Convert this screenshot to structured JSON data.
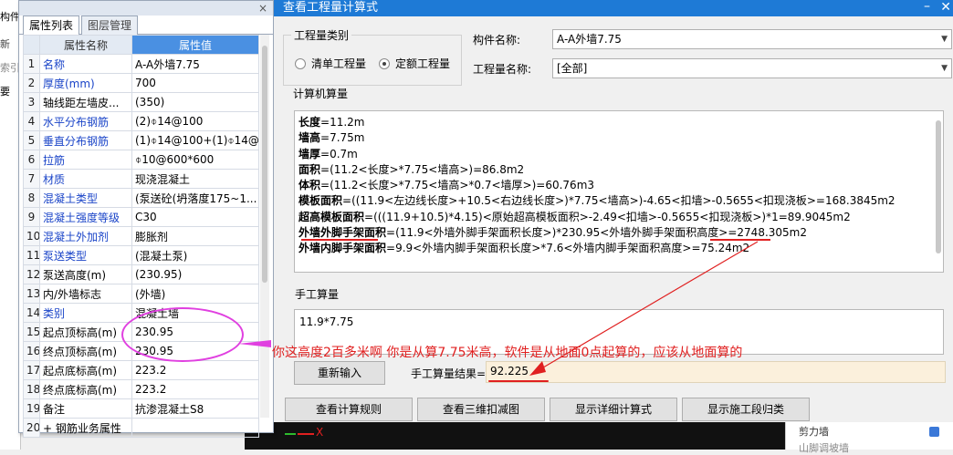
{
  "background": {
    "left_items": [
      "构件",
      "新",
      "索引",
      "要"
    ]
  },
  "bg_list": {
    "item": "剪力墙",
    "item2": "山脚调坡墙"
  },
  "property_panel": {
    "tabs": [
      "属性列表",
      "图层管理"
    ],
    "active_tab": 0,
    "close": "×",
    "headers": {
      "name": "属性名称",
      "value": "属性值"
    },
    "rows": [
      {
        "idx": "1",
        "name": "名称",
        "value": "A-A外墙7.75",
        "blue": true
      },
      {
        "idx": "2",
        "name": "厚度(mm)",
        "value": "700",
        "blue": true
      },
      {
        "idx": "3",
        "name": "轴线距左墙皮...",
        "value": "(350)",
        "blue": false
      },
      {
        "idx": "4",
        "name": "水平分布钢筋",
        "value": "(2)⌽14@100",
        "blue": true
      },
      {
        "idx": "5",
        "name": "垂直分布钢筋",
        "value": "(1)⌽14@100+(1)⌽14@",
        "blue": true
      },
      {
        "idx": "6",
        "name": "拉筋",
        "value": "⌽10@600*600",
        "blue": true
      },
      {
        "idx": "7",
        "name": "材质",
        "value": "现浇混凝土",
        "blue": true
      },
      {
        "idx": "8",
        "name": "混凝土类型",
        "value": "(泵送砼(坍落度175~1...",
        "blue": true
      },
      {
        "idx": "9",
        "name": "混凝土强度等级",
        "value": "C30",
        "blue": true
      },
      {
        "idx": "10",
        "name": "混凝土外加剂",
        "value": "膨胀剂",
        "blue": true
      },
      {
        "idx": "11",
        "name": "泵送类型",
        "value": "(混凝土泵)",
        "blue": true
      },
      {
        "idx": "12",
        "name": "泵送高度(m)",
        "value": "(230.95)",
        "blue": false
      },
      {
        "idx": "13",
        "name": "内/外墙标志",
        "value": "(外墙)",
        "blue": false
      },
      {
        "idx": "14",
        "name": "类别",
        "value": "混凝土墙",
        "blue": true
      },
      {
        "idx": "15",
        "name": "起点顶标高(m)",
        "value": "230.95",
        "blue": false
      },
      {
        "idx": "16",
        "name": "终点顶标高(m)",
        "value": "230.95",
        "blue": false
      },
      {
        "idx": "17",
        "name": "起点底标高(m)",
        "value": "223.2",
        "blue": false
      },
      {
        "idx": "18",
        "name": "终点底标高(m)",
        "value": "223.2",
        "blue": false
      },
      {
        "idx": "19",
        "name": "备注",
        "value": "抗渗混凝土S8",
        "blue": false
      },
      {
        "idx": "20",
        "name": "+ 钢筋业务属性",
        "value": "",
        "blue": false
      }
    ]
  },
  "dialog": {
    "title": "查看工程量计算式",
    "qty_type_group": "工程量类别",
    "radio_list": "清单工程量",
    "radio_quota": "定额工程量",
    "radio_selected": "quota",
    "component_label": "构件名称:",
    "component_value": "A-A外墙7.75",
    "qty_name_label": "工程量名称:",
    "qty_name_value": "[全部]",
    "calc_group": "计算机算量",
    "calc_lines": [
      {
        "bold": "长度",
        "rest": "=11.2m"
      },
      {
        "bold": "墙高",
        "rest": "=7.75m"
      },
      {
        "bold": "墙厚",
        "rest": "=0.7m"
      },
      {
        "bold": "面积",
        "rest": "=(11.2<长度>*7.75<墙高>)=86.8m2"
      },
      {
        "bold": "体积",
        "rest": "=(11.2<长度>*7.75<墙高>*0.7<墙厚>)=60.76m3"
      },
      {
        "bold": "模板面积",
        "rest": "=((11.9<左边线长度>+10.5<右边线长度>)*7.75<墙高>)-4.65<扣墙>-0.5655<扣现浇板>=168.3845m2"
      },
      {
        "bold": "超高模板面积",
        "rest": "=(((11.9+10.5)*4.15)<原始超高模板面积>-2.49<扣墙>-0.5655<扣现浇板>)*1=89.9045m2"
      },
      {
        "bold": "外墙外脚手架面积",
        "rest": "=(11.9<外墙外脚手架面积长度>)*230.95<外墙外脚手架面积高度>=2748.305m2"
      },
      {
        "bold": "外墙内脚手架面积",
        "rest": "=9.9<外墙内脚手架面积长度>*7.6<外墙内脚手架面积高度>=75.24m2"
      }
    ],
    "manual_group": "手工算量",
    "manual_value": "11.9*7.75",
    "reenter_button": "重新输入",
    "result_label": "手工算量结果=",
    "result_value": "92.225",
    "buttons": [
      "查看计算规则",
      "查看三维扣减图",
      "显示详细计算式",
      "显示施工段归类"
    ]
  },
  "annotation": "你这高度2百多米啊   你是从算7.75米高，软件是从地面0点起算的，应该从地面算的",
  "colors": {
    "title_bar": "#1e7ad6",
    "annotation": "#e02020",
    "highlight": "#e040e0",
    "header_value": "#4a90e2"
  }
}
